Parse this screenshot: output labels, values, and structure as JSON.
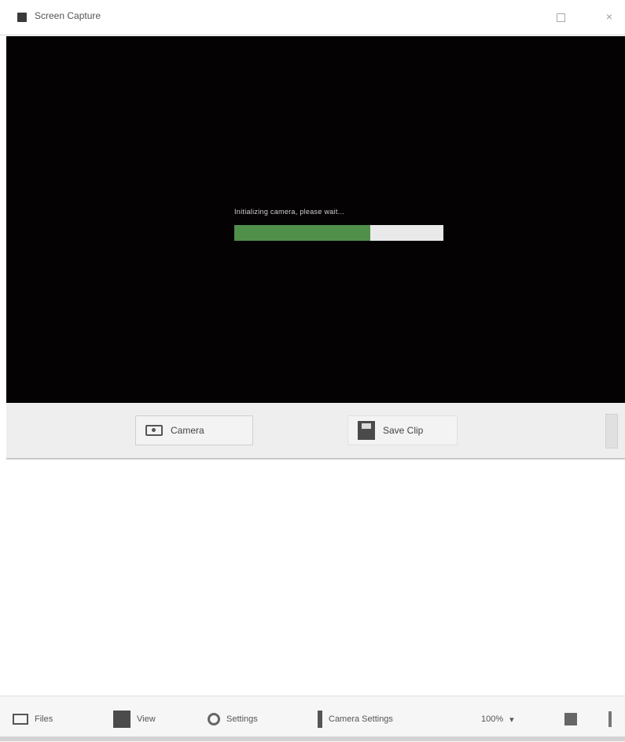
{
  "window": {
    "title": "Screen Capture",
    "maximize_label": "",
    "close_label": "×"
  },
  "preview": {
    "overlay_text": "Initializing camera, please wait...",
    "progress": {
      "fraction": 0.65,
      "label": ""
    }
  },
  "controls": {
    "camera_button": "Camera",
    "save_button": "Save Clip"
  },
  "statusbar": {
    "files_label": "Files",
    "view_label": "View",
    "settings_label": "Settings",
    "cameras_label": "Camera Settings",
    "size_label": "100%",
    "size_dropdown": "▾"
  },
  "colors": {
    "preview_bg": "#050203",
    "progress_fill": "#4f8f4a",
    "progress_track": "#e9e9e9"
  }
}
